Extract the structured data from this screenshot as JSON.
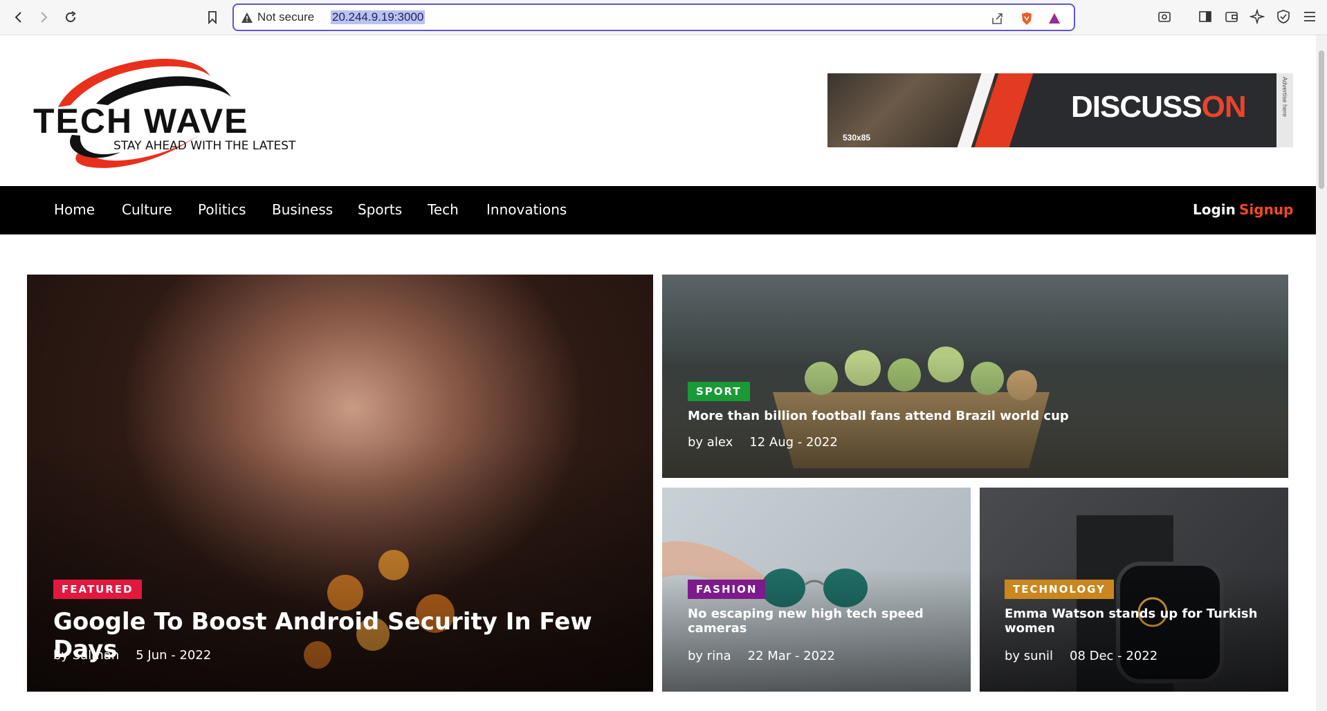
{
  "browser": {
    "security_label": "Not secure",
    "url": "20.244.9.19:3000"
  },
  "site": {
    "logo_title": "TECH WAVE",
    "logo_tagline": "STAY AHEAD WITH THE LATEST",
    "ad": {
      "brand_main": "DISCUSS",
      "brand_accent": "ON",
      "size_label": "530x85",
      "side_label": "Advertise here"
    }
  },
  "nav": {
    "items": [
      "Home",
      "Culture",
      "Politics",
      "Business",
      "Sports",
      "Tech",
      "Innovations"
    ],
    "login": "Login",
    "signup": "Signup"
  },
  "articles": [
    {
      "category": "FEATURED",
      "category_color": "#e2183f",
      "title": "Google To Boost Android Security In Few Days",
      "author": "by Salman",
      "date": "5 Jun - 2022"
    },
    {
      "category": "SPORT",
      "category_color": "#1a9a37",
      "title": "More than billion football fans attend Brazil world cup",
      "author": "by alex",
      "date": "12 Aug - 2022"
    },
    {
      "category": "FASHION",
      "category_color": "#7e1b8c",
      "title": "No escaping new high tech speed cameras",
      "author": "by rina",
      "date": "22 Mar - 2022"
    },
    {
      "category": "TECHNOLOGY",
      "category_color": "#c9871f",
      "title": "Emma Watson stands up for Turkish women",
      "author": "by sunil",
      "date": "08 Dec - 2022"
    }
  ],
  "colors": {
    "accent": "#f04a25",
    "nav_bg": "#000000",
    "url_outline": "#5b55d9"
  }
}
